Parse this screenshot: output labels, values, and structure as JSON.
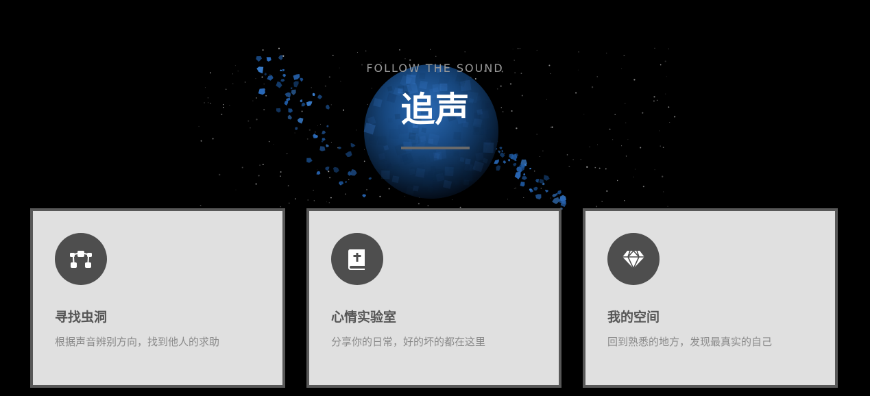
{
  "hero": {
    "tagline": "FOLLOW THE SOUND",
    "title": "追声"
  },
  "features": [
    {
      "icon": "vector-nodes-icon",
      "title": "寻找虫洞",
      "description": "根据声音辨别方向，找到他人的求助"
    },
    {
      "icon": "bible-book-icon",
      "title": "心情实验室",
      "description": "分享你的日常，好的坏的都在这里"
    },
    {
      "icon": "diamond-icon",
      "title": "我的空间",
      "description": "回到熟悉的地方，发现最真实的自己"
    }
  ],
  "colors": {
    "background": "#000000",
    "card": "#e0e0e0",
    "card_border": "#585858",
    "icon_circle": "#4e4e4e",
    "planet": "#1e5fa8"
  }
}
